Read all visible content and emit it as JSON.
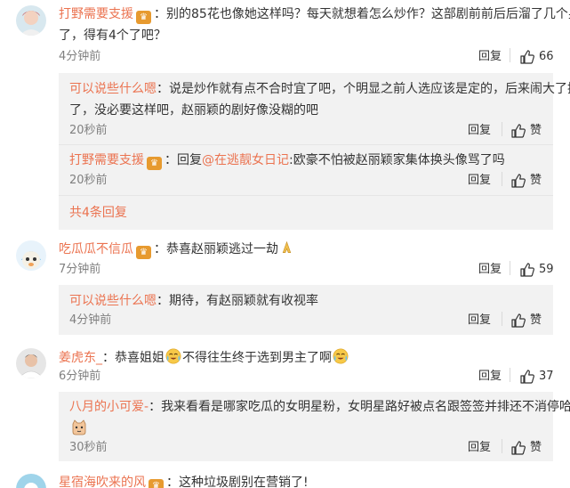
{
  "comments": [
    {
      "user": "打野需要支援",
      "text_line1": "别的85花也像她这样吗？每天就想着怎么炒作？这部剧前前后后溜了几个男的",
      "text_line2": "了，得有4个了吧？",
      "time": "4分钟前",
      "reply_label": "回复",
      "likes": "66",
      "replies": [
        {
          "user": "可以说些什么嗯",
          "text_line1": "说是炒作就有点不合时宜了吧，个明显之前人选应该是定的，后来闹大了换",
          "text_line2": "了，没必要这样吧，赵丽颖的剧好像没糊的吧",
          "time": "20秒前",
          "reply_label": "回复",
          "like_label": "赞"
        },
        {
          "user": "打野需要支援",
          "reply_prefix": "回复",
          "mention": "@在逃靓女日记",
          "text": ":欧豪不怕被赵丽颖家集体换头像骂了吗",
          "time": "20秒前",
          "reply_label": "回复",
          "like_label": "赞"
        }
      ],
      "more_replies": "共4条回复"
    },
    {
      "user": "吃瓜瓜不信瓜",
      "text": "恭喜赵丽颖逃过一劫",
      "time": "7分钟前",
      "reply_label": "回复",
      "likes": "59",
      "replies": [
        {
          "user": "可以说些什么嗯",
          "text": "期待，有赵丽颖就有收视率",
          "time": "4分钟前",
          "reply_label": "回复",
          "like_label": "赞"
        }
      ]
    },
    {
      "user": "姜虎东_",
      "text_a": "恭喜姐姐",
      "text_b": "不得往生终于选到男主了啊",
      "time": "6分钟前",
      "reply_label": "回复",
      "likes": "37",
      "replies": [
        {
          "user": "八月的小可爱-",
          "text": "我来看看是哪家吃瓜的女明星粉，女明星路好被点名跟签签并排还不消停哈",
          "time": "30秒前",
          "reply_label": "回复",
          "like_label": "赞"
        }
      ]
    },
    {
      "user": "星宿海吹来的风",
      "text": "这种垃圾剧别在营销了!"
    }
  ],
  "colors": {
    "username": "#eb7350",
    "reply_bg": "#f2f2f2",
    "time": "#808080",
    "badge": "#e79a2f"
  },
  "icons": {
    "like": "thumb-up-icon",
    "badge": "member-badge-icon",
    "pray": "pray-emoji-icon",
    "cry": "tears-of-joy-emoji-icon",
    "cat": "cat-emoji-icon"
  }
}
